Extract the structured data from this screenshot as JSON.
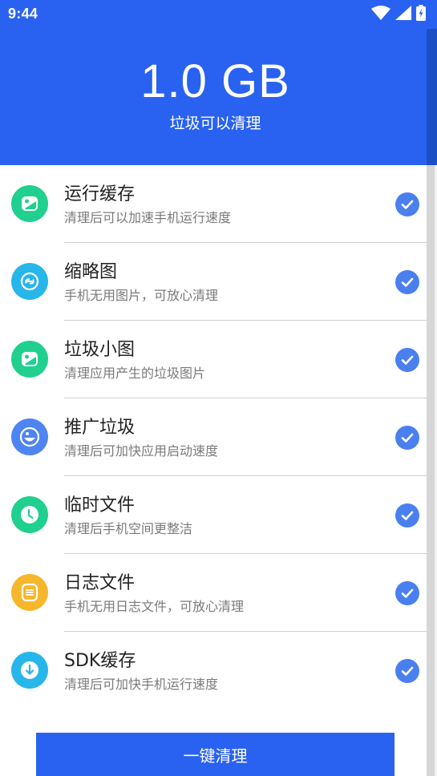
{
  "status_bar": {
    "time": "9:44",
    "icons": [
      "wifi-icon",
      "signal-icon",
      "battery-charging-icon"
    ]
  },
  "summary": {
    "size": "1.0 GB",
    "caption": "垃圾可以清理"
  },
  "colors": {
    "header_bg": "#2962f0",
    "check": "#4a7ff0",
    "button_bg": "#2962f0"
  },
  "items": [
    {
      "title": "运行缓存",
      "desc": "清理后可以加速手机运行速度",
      "icon": "photo-icon",
      "color": "#1fd08f",
      "checked": true
    },
    {
      "title": "缩略图",
      "desc": "手机无用图片，可放心清理",
      "icon": "link-icon",
      "color": "#27b6ea",
      "checked": true
    },
    {
      "title": "垃圾小图",
      "desc": "清理应用产生的垃圾图片",
      "icon": "photo-icon",
      "color": "#1fd08f",
      "checked": true
    },
    {
      "title": "推广垃圾",
      "desc": "清理后可加快应用启动速度",
      "icon": "camera-icon",
      "color": "#4f85f0",
      "checked": true
    },
    {
      "title": "临时文件",
      "desc": "清理后手机空间更整洁",
      "icon": "clock-icon",
      "color": "#1fd08f",
      "checked": true
    },
    {
      "title": "日志文件",
      "desc": "手机无用日志文件，可放心清理",
      "icon": "log-icon",
      "color": "#f6b72c",
      "checked": true
    },
    {
      "title": "SDK缓存",
      "desc": "清理后可加快手机运行速度",
      "icon": "download-icon",
      "color": "#27b6ea",
      "checked": true
    }
  ],
  "action": {
    "label": "一键清理"
  }
}
